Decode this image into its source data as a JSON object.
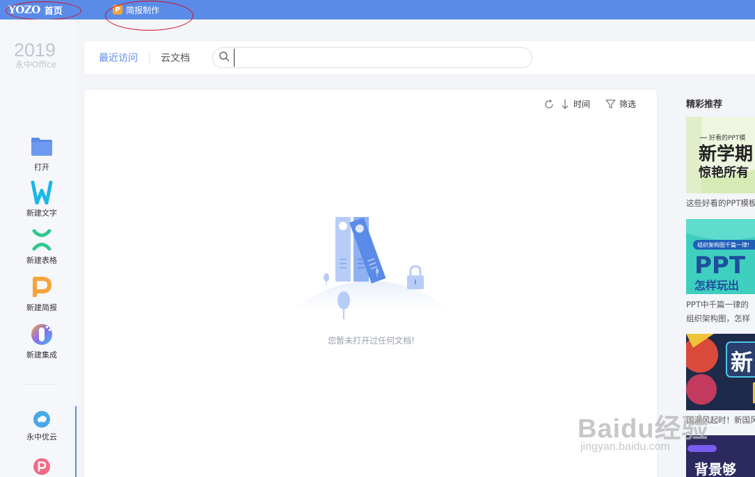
{
  "topbar": {
    "brand_logo": "YOZO",
    "home_label": "首页",
    "tab_icon_letter": "P",
    "tab_label": "简报制作",
    "bar_color": "#5b8be8"
  },
  "sidebar": {
    "version_year": "2019",
    "product_name": "永中Office",
    "items": [
      {
        "label": "打开",
        "icon": "folder-icon"
      },
      {
        "label": "新建文字",
        "icon": "word-icon"
      },
      {
        "label": "新建表格",
        "icon": "sheet-icon"
      },
      {
        "label": "新建简报",
        "icon": "presentation-icon"
      },
      {
        "label": "新建集成",
        "icon": "integration-icon"
      },
      {
        "label": "永中优云",
        "icon": "cloud-icon"
      }
    ]
  },
  "header": {
    "tab_recent": "最近访问",
    "tab_cloud": "云文档",
    "search_value": ""
  },
  "panel": {
    "sort_label": "时间",
    "filter_label": "筛选",
    "empty_message": "您暂未打开过任何文档!"
  },
  "recommend": {
    "title": "精彩推荐",
    "items": [
      {
        "image_line1": "好看的PPT模",
        "image_line2": "新学期",
        "image_line3": "惊艳所有",
        "caption": "这些好看的PPT模板"
      },
      {
        "image_line1": "组织架构图千篇一律!",
        "image_line2": "PPT",
        "image_line3": "怎样玩出",
        "caption": "PPT中千篇一律的组织架构图，怎样玩出新鲜感？"
      },
      {
        "image_line1": "新",
        "caption": "国潮风起时！新国风"
      },
      {
        "image_line1": "背景够",
        "caption": ""
      }
    ]
  },
  "watermark": {
    "big": "Baidu经验",
    "small": "jingyan.baidu.com"
  }
}
